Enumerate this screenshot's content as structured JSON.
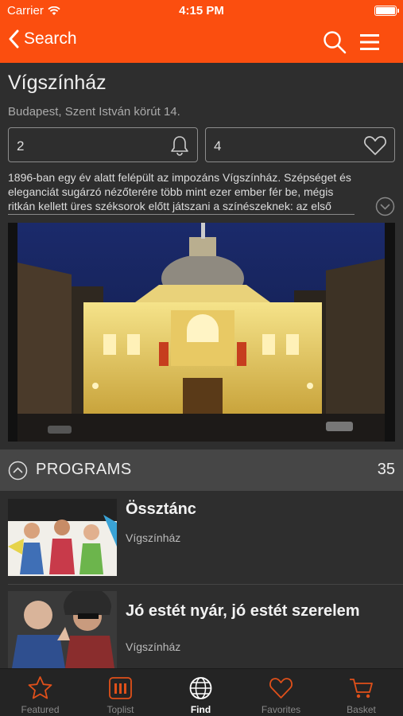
{
  "status_bar": {
    "carrier": "Carrier",
    "time": "4:15 PM"
  },
  "nav": {
    "back_label": "Search",
    "search_icon": "search-icon",
    "menu_icon": "hamburger-icon"
  },
  "venue": {
    "title": "Vígszínház",
    "address": "Budapest, Szent István körút 14.",
    "reminders": "2",
    "favorites": "4",
    "description": "1896-ban egy év alatt felépült az impozáns Vígszínház. Szépséget és eleganciát sugárzó nézőterére több mint ezer ember fér be, mégis ritkán kellett üres széksorok előtt játszani a színészeknek: az első"
  },
  "programs": {
    "label": "PROGRAMS",
    "count": "35",
    "items": [
      {
        "name": "Össztánc",
        "venue": "Vígszínház"
      },
      {
        "name": "Jó estét nyár, jó estét szerelem",
        "venue": "Vígszínház"
      }
    ]
  },
  "tabs": [
    {
      "label": "Featured",
      "icon": "star-icon"
    },
    {
      "label": "Toplist",
      "icon": "toplist-icon"
    },
    {
      "label": "Find",
      "icon": "globe-icon"
    },
    {
      "label": "Favorites",
      "icon": "heart-icon"
    },
    {
      "label": "Basket",
      "icon": "cart-icon"
    }
  ],
  "colors": {
    "accent": "#fb4e0f",
    "background": "#2e2e2e",
    "tab_active": "#ffffff"
  }
}
